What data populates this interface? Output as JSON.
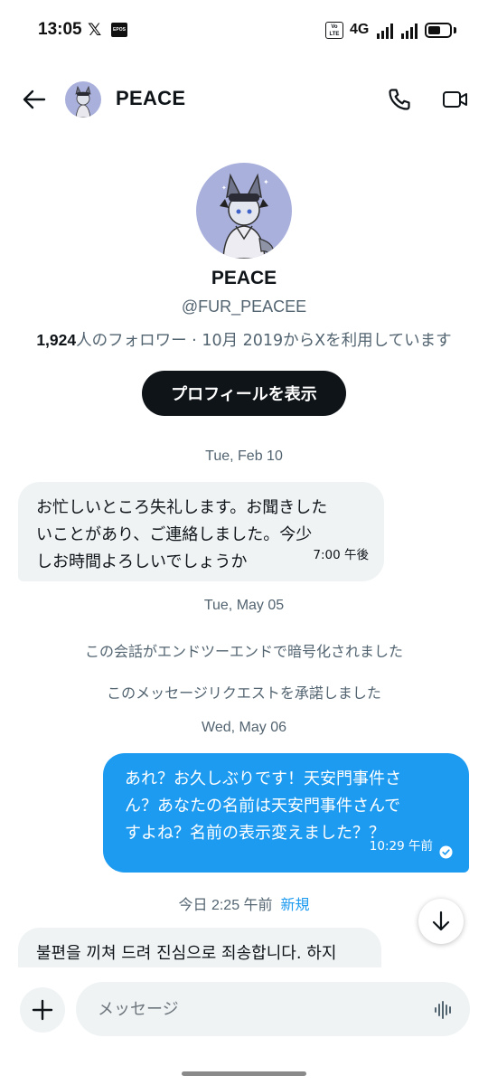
{
  "status_bar": {
    "time": "13:05",
    "x_glyph": "𝕏",
    "epos_label": "EPOS",
    "volte_label": "Vo LTE",
    "network": "4G",
    "icons": [
      "x-app-icon",
      "epos-app-icon",
      "volte-icon",
      "signal-icon",
      "battery-icon"
    ]
  },
  "header": {
    "title": "PEACE",
    "icons": [
      "back-arrow-icon",
      "phone-icon",
      "video-camera-icon"
    ]
  },
  "profile": {
    "name": "PEACE",
    "handle": "@FUR_PEACEE",
    "followers_count": "1,924",
    "meta_text": "人のフォロワー · 10月 2019からXを利用しています",
    "view_profile_label": "プロフィールを表示"
  },
  "conversation": {
    "date1": "Tue, Feb 10",
    "msg1": {
      "lines": [
        "お忙しいところ失礼します。お聞きした",
        "いことがあり、ご連絡しました。今少",
        "しお時間よろしいでしょうか"
      ],
      "time": "7:00 午後"
    },
    "date2": "Tue, May 05",
    "note1": "この会話がエンドツーエンドで暗号化されました",
    "note2": "このメッセージリクエストを承諾しました",
    "date3": "Wed, May 06",
    "msg2": {
      "lines": [
        "あれ？お久しぶりです！天安門事件さ",
        "ん？あなたの名前は天安門事件さんで",
        "すよね？名前の表示変えました？？"
      ],
      "time": "10:29 午前"
    },
    "date4_time": "今日 2:25 午前",
    "date4_new": "新規",
    "msg3": {
      "lines": [
        "불편을 끼쳐 드려 진심으로 죄송합니다. 하지"
      ]
    }
  },
  "composer": {
    "placeholder": "メッセージ"
  },
  "colors": {
    "accent": "#1d9bf0",
    "incoming_bubble": "#eff3f4",
    "primary_text": "#0f1419",
    "secondary_text": "#536471"
  }
}
